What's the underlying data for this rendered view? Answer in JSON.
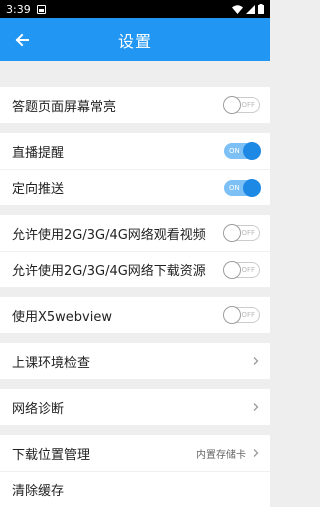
{
  "status_bar": {
    "time": "3:39"
  },
  "app_bar": {
    "title": "设置"
  },
  "colors": {
    "accent": "#2196f3",
    "toggle_on": "#1e88e5"
  },
  "settings": {
    "screen_always_on": {
      "label": "答题页面屏幕常亮",
      "state": "OFF"
    },
    "live_reminder": {
      "label": "直播提醒",
      "state": "ON"
    },
    "targeted_push": {
      "label": "定向推送",
      "state": "ON"
    },
    "mobile_video": {
      "label": "允许使用2G/3G/4G网络观看视频",
      "state": "OFF"
    },
    "mobile_download": {
      "label": "允许使用2G/3G/4G网络下载资源",
      "state": "OFF"
    },
    "x5webview": {
      "label": "使用X5webview",
      "state": "OFF"
    },
    "env_check": {
      "label": "上课环境检查"
    },
    "network_diag": {
      "label": "网络诊断"
    },
    "download_location": {
      "label": "下载位置管理",
      "value": "内置存储卡"
    },
    "clear_cache": {
      "label": "清除缓存"
    }
  }
}
